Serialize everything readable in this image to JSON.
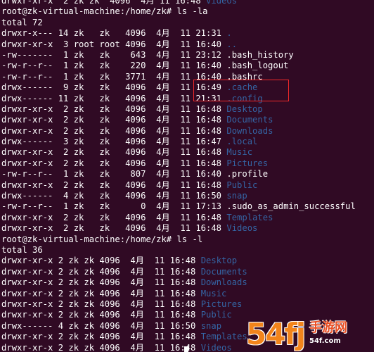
{
  "terminal": {
    "lines": [
      {
        "text": "drwxr-xr-x  2 zk zk  4096  4月 11 16:48 ",
        "dir": "Videos"
      },
      {
        "text": "root@zk-virtual-machine:/home/zk# ls -la",
        "dir": ""
      },
      {
        "text": "total 72",
        "dir": ""
      },
      {
        "text": "drwxr-x--- 14 zk   zk   4096  4月  11 21:31 ",
        "dir": "."
      },
      {
        "text": "drwxr-xr-x  3 root root 4096  4月  11 16:40 ",
        "dir": ".."
      },
      {
        "text": "-rw-------  1 zk   zk    643  4月  11 23:12 .bash_history",
        "dir": ""
      },
      {
        "text": "-rw-r--r--  1 zk   zk    220  4月  11 16:40 .bash_logout",
        "dir": ""
      },
      {
        "text": "-rw-r--r--  1 zk   zk   3771  4月  11 16:40 .bashrc",
        "dir": ""
      },
      {
        "text": "drwx------  9 zk   zk   4096  4月  11 16:49 ",
        "dir": ".cache"
      },
      {
        "text": "drwx------ 11 zk   zk   4096  4月  11 21:31 ",
        "dir": ".config"
      },
      {
        "text": "drwxr-xr-x  2 zk   zk   4096  4月  11 16:48 ",
        "dir": "Desktop"
      },
      {
        "text": "drwxr-xr-x  2 zk   zk   4096  4月  11 16:48 ",
        "dir": "Documents"
      },
      {
        "text": "drwxr-xr-x  2 zk   zk   4096  4月  11 16:48 ",
        "dir": "Downloads"
      },
      {
        "text": "drwx------  3 zk   zk   4096  4月  11 16:47 ",
        "dir": ".local"
      },
      {
        "text": "drwxr-xr-x  2 zk   zk   4096  4月  11 16:48 ",
        "dir": "Music"
      },
      {
        "text": "drwxr-xr-x  2 zk   zk   4096  4月  11 16:48 ",
        "dir": "Pictures"
      },
      {
        "text": "-rw-r--r--  1 zk   zk    807  4月  11 16:40 .profile",
        "dir": ""
      },
      {
        "text": "drwxr-xr-x  2 zk   zk   4096  4月  11 16:48 ",
        "dir": "Public"
      },
      {
        "text": "drwx------  4 zk   zk   4096  4月  11 16:50 ",
        "dir": "snap"
      },
      {
        "text": "-rw-r--r--  1 zk   zk      0  4月  11 17:13 .sudo_as_admin_successful",
        "dir": ""
      },
      {
        "text": "drwxr-xr-x  2 zk   zk   4096  4月  11 16:48 ",
        "dir": "Templates"
      },
      {
        "text": "drwxr-xr-x  2 zk   zk   4096  4月  11 16:48 ",
        "dir": "Videos"
      },
      {
        "text": "root@zk-virtual-machine:/home/zk# ls -l",
        "dir": ""
      },
      {
        "text": "total 36",
        "dir": ""
      },
      {
        "text": "drwxr-xr-x 2 zk zk 4096  4月  11 16:48 ",
        "dir": "Desktop"
      },
      {
        "text": "drwxr-xr-x 2 zk zk 4096  4月  11 16:48 ",
        "dir": "Documents"
      },
      {
        "text": "drwxr-xr-x 2 zk zk 4096  4月  11 16:48 ",
        "dir": "Downloads"
      },
      {
        "text": "drwxr-xr-x 2 zk zk 4096  4月  11 16:48 ",
        "dir": "Music"
      },
      {
        "text": "drwxr-xr-x 2 zk zk 4096  4月  11 16:48 ",
        "dir": "Pictures"
      },
      {
        "text": "drwxr-xr-x 2 zk zk 4096  4月  11 16:48 ",
        "dir": "Public"
      },
      {
        "text": "drwx------ 4 zk zk 4096  4月  11 16:50 ",
        "dir": "snap"
      },
      {
        "text": "drwxr-xr-x 2 zk zk 4096  4月  11 16:48 ",
        "dir": "Templates"
      },
      {
        "text": "drwxr-xr-x 2 zk zk 4096  4月  11 16:48 ",
        "dir": "Videos"
      }
    ]
  },
  "watermark": {
    "logo": "54",
    "glyph": "fj",
    "name": "手游网",
    "url": "54f.com"
  },
  "colors": {
    "background": "#300a24",
    "text": "#ffffff",
    "directory": "#3465a4",
    "highlight_border": "#ef2929",
    "watermark_orange": "#f2841b"
  }
}
